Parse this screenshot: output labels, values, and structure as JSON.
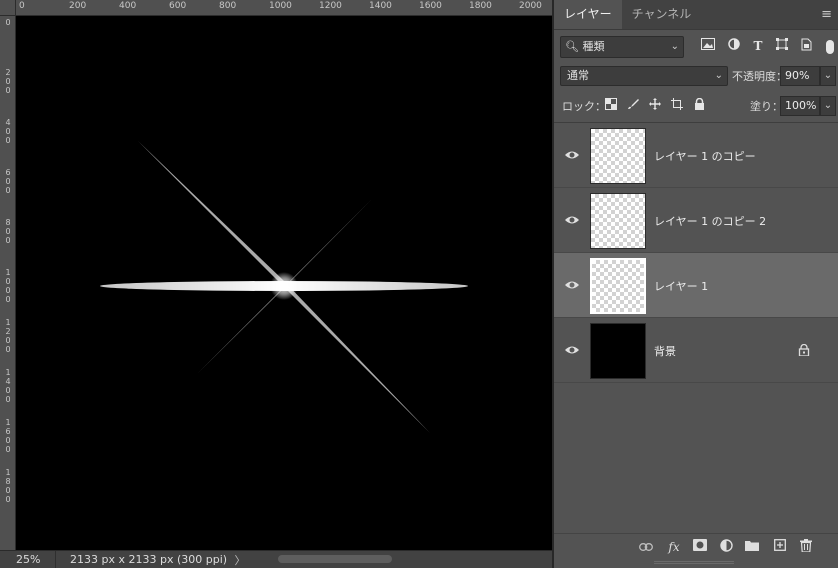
{
  "ruler": {
    "top_labels": [
      "0",
      "200",
      "400",
      "600",
      "800",
      "1000",
      "1200",
      "1400",
      "1600",
      "1800",
      "2000"
    ],
    "left_labels": [
      "0",
      "200",
      "400",
      "600",
      "800",
      "1000",
      "1200",
      "1400",
      "1600",
      "1800"
    ]
  },
  "status": {
    "zoom": "25%",
    "doc_info": "2133 px x 2133 px (300 ppi)",
    "arrow": "〉"
  },
  "panel": {
    "tabs": [
      "レイヤー",
      "チャンネル"
    ],
    "active_tab": 0,
    "menu_icon": "≡",
    "filter": {
      "value": "種類",
      "icon": "search-icon"
    },
    "blend_mode": "通常",
    "opacity_label": "不透明度：",
    "opacity_value": "90%",
    "lock_label": "ロック：",
    "fill_label": "塗り：",
    "fill_value": "100%",
    "layers": [
      {
        "name": "レイヤー 1 のコピー",
        "thumb": "transparent",
        "selected": false,
        "locked": false
      },
      {
        "name": "レイヤー 1 のコピー 2",
        "thumb": "transparent",
        "selected": false,
        "locked": false
      },
      {
        "name": "レイヤー 1",
        "thumb": "transparent",
        "selected": true,
        "locked": false
      },
      {
        "name": "背景",
        "thumb": "black",
        "selected": false,
        "locked": true
      }
    ],
    "bottom_icons": [
      "link-icon",
      "fx-icon",
      "mask-icon",
      "adjustment-icon",
      "folder-icon",
      "new-layer-icon",
      "trash-icon"
    ]
  },
  "colors": {
    "panel_bg": "#535353",
    "selected_row": "#6a6a6a",
    "canvas_bg": "#000000"
  }
}
